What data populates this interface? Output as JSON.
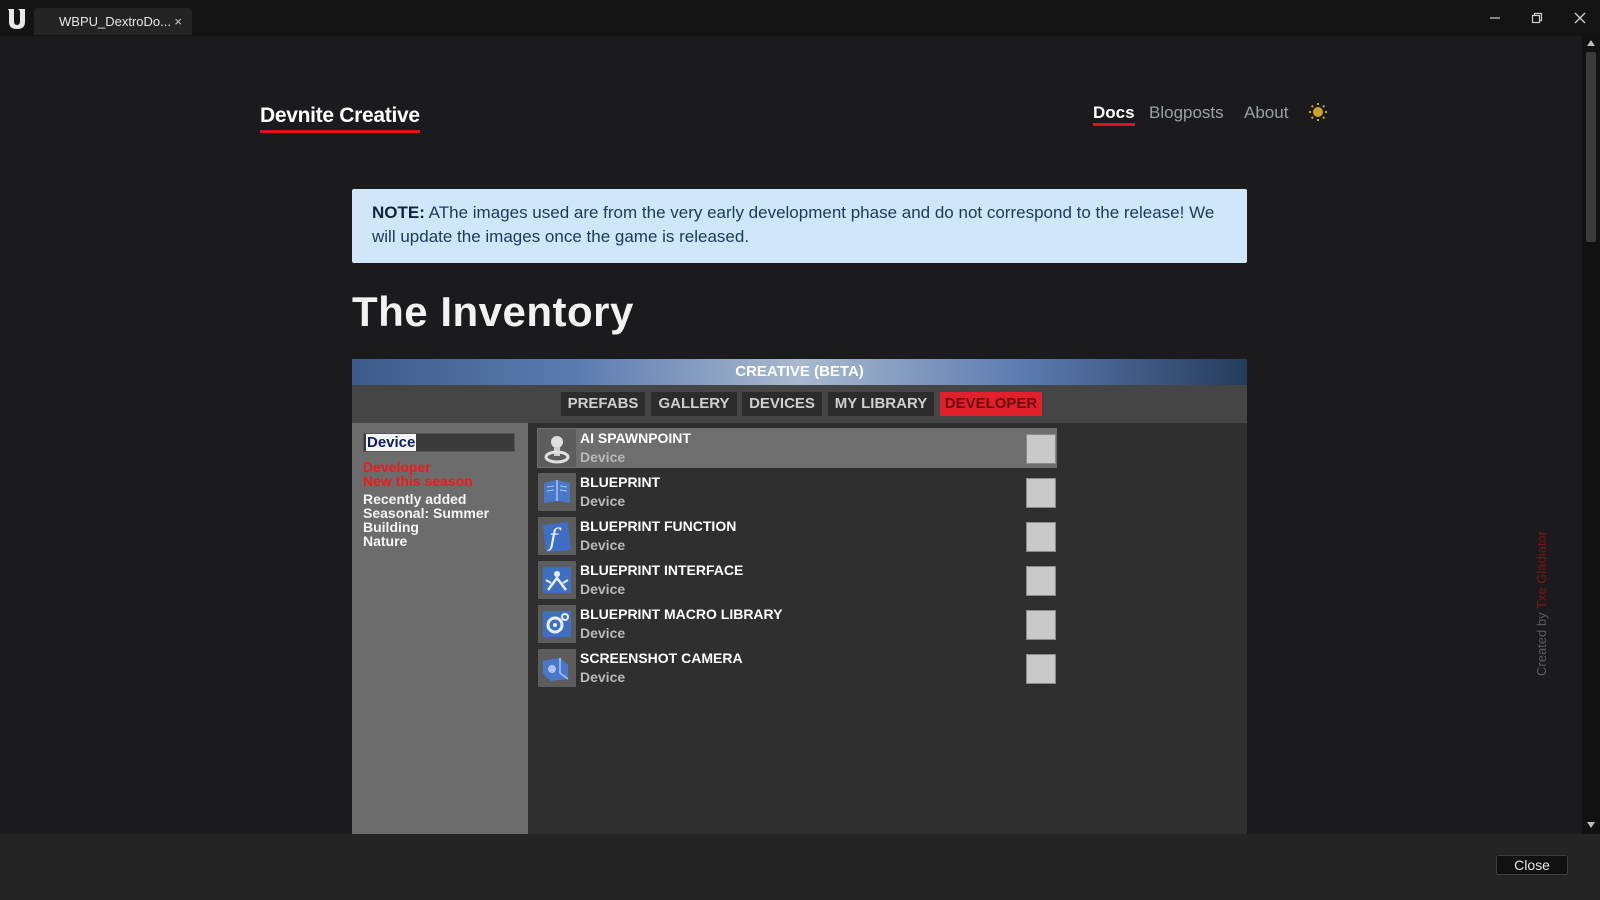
{
  "window": {
    "tab_title": "WBPU_DextroDo...",
    "tab_close": "×"
  },
  "site": {
    "brand": "Devnite Creative",
    "nav": {
      "docs": "Docs",
      "blogposts": "Blogposts",
      "about": "About"
    }
  },
  "note": {
    "label": "NOTE:",
    "text": " AThe images used are from the very early development phase and do not correspond to the release! We will update the images once the game is released."
  },
  "page_title": "The Inventory",
  "inventory": {
    "header": "CREATIVE (BETA)",
    "tabs": [
      "PREFABS",
      "GALLERY",
      "DEVICES",
      "MY LIBRARY",
      "DEVELOPER"
    ],
    "search_value": "Device",
    "categories_red": [
      "Developer",
      "New this season"
    ],
    "categories": [
      "Recently added",
      "Seasonal: Summer",
      "Building",
      "Nature"
    ],
    "items": [
      {
        "name": "AI SPAWNPOINT",
        "type": "Device"
      },
      {
        "name": "BLUEPRINT",
        "type": "Device"
      },
      {
        "name": "BLUEPRINT FUNCTION",
        "type": "Device"
      },
      {
        "name": "BLUEPRINT INTERFACE",
        "type": "Device"
      },
      {
        "name": "BLUEPRINT MACRO LIBRARY",
        "type": "Device"
      },
      {
        "name": "SCREENSHOT CAMERA",
        "type": "Device"
      }
    ]
  },
  "created_by": {
    "prefix": "Created by ",
    "author": "Txe Gladiator"
  },
  "footer": {
    "close": "Close"
  },
  "colors": {
    "accent": "#e0121f",
    "note_bg": "#cfe6fb"
  }
}
